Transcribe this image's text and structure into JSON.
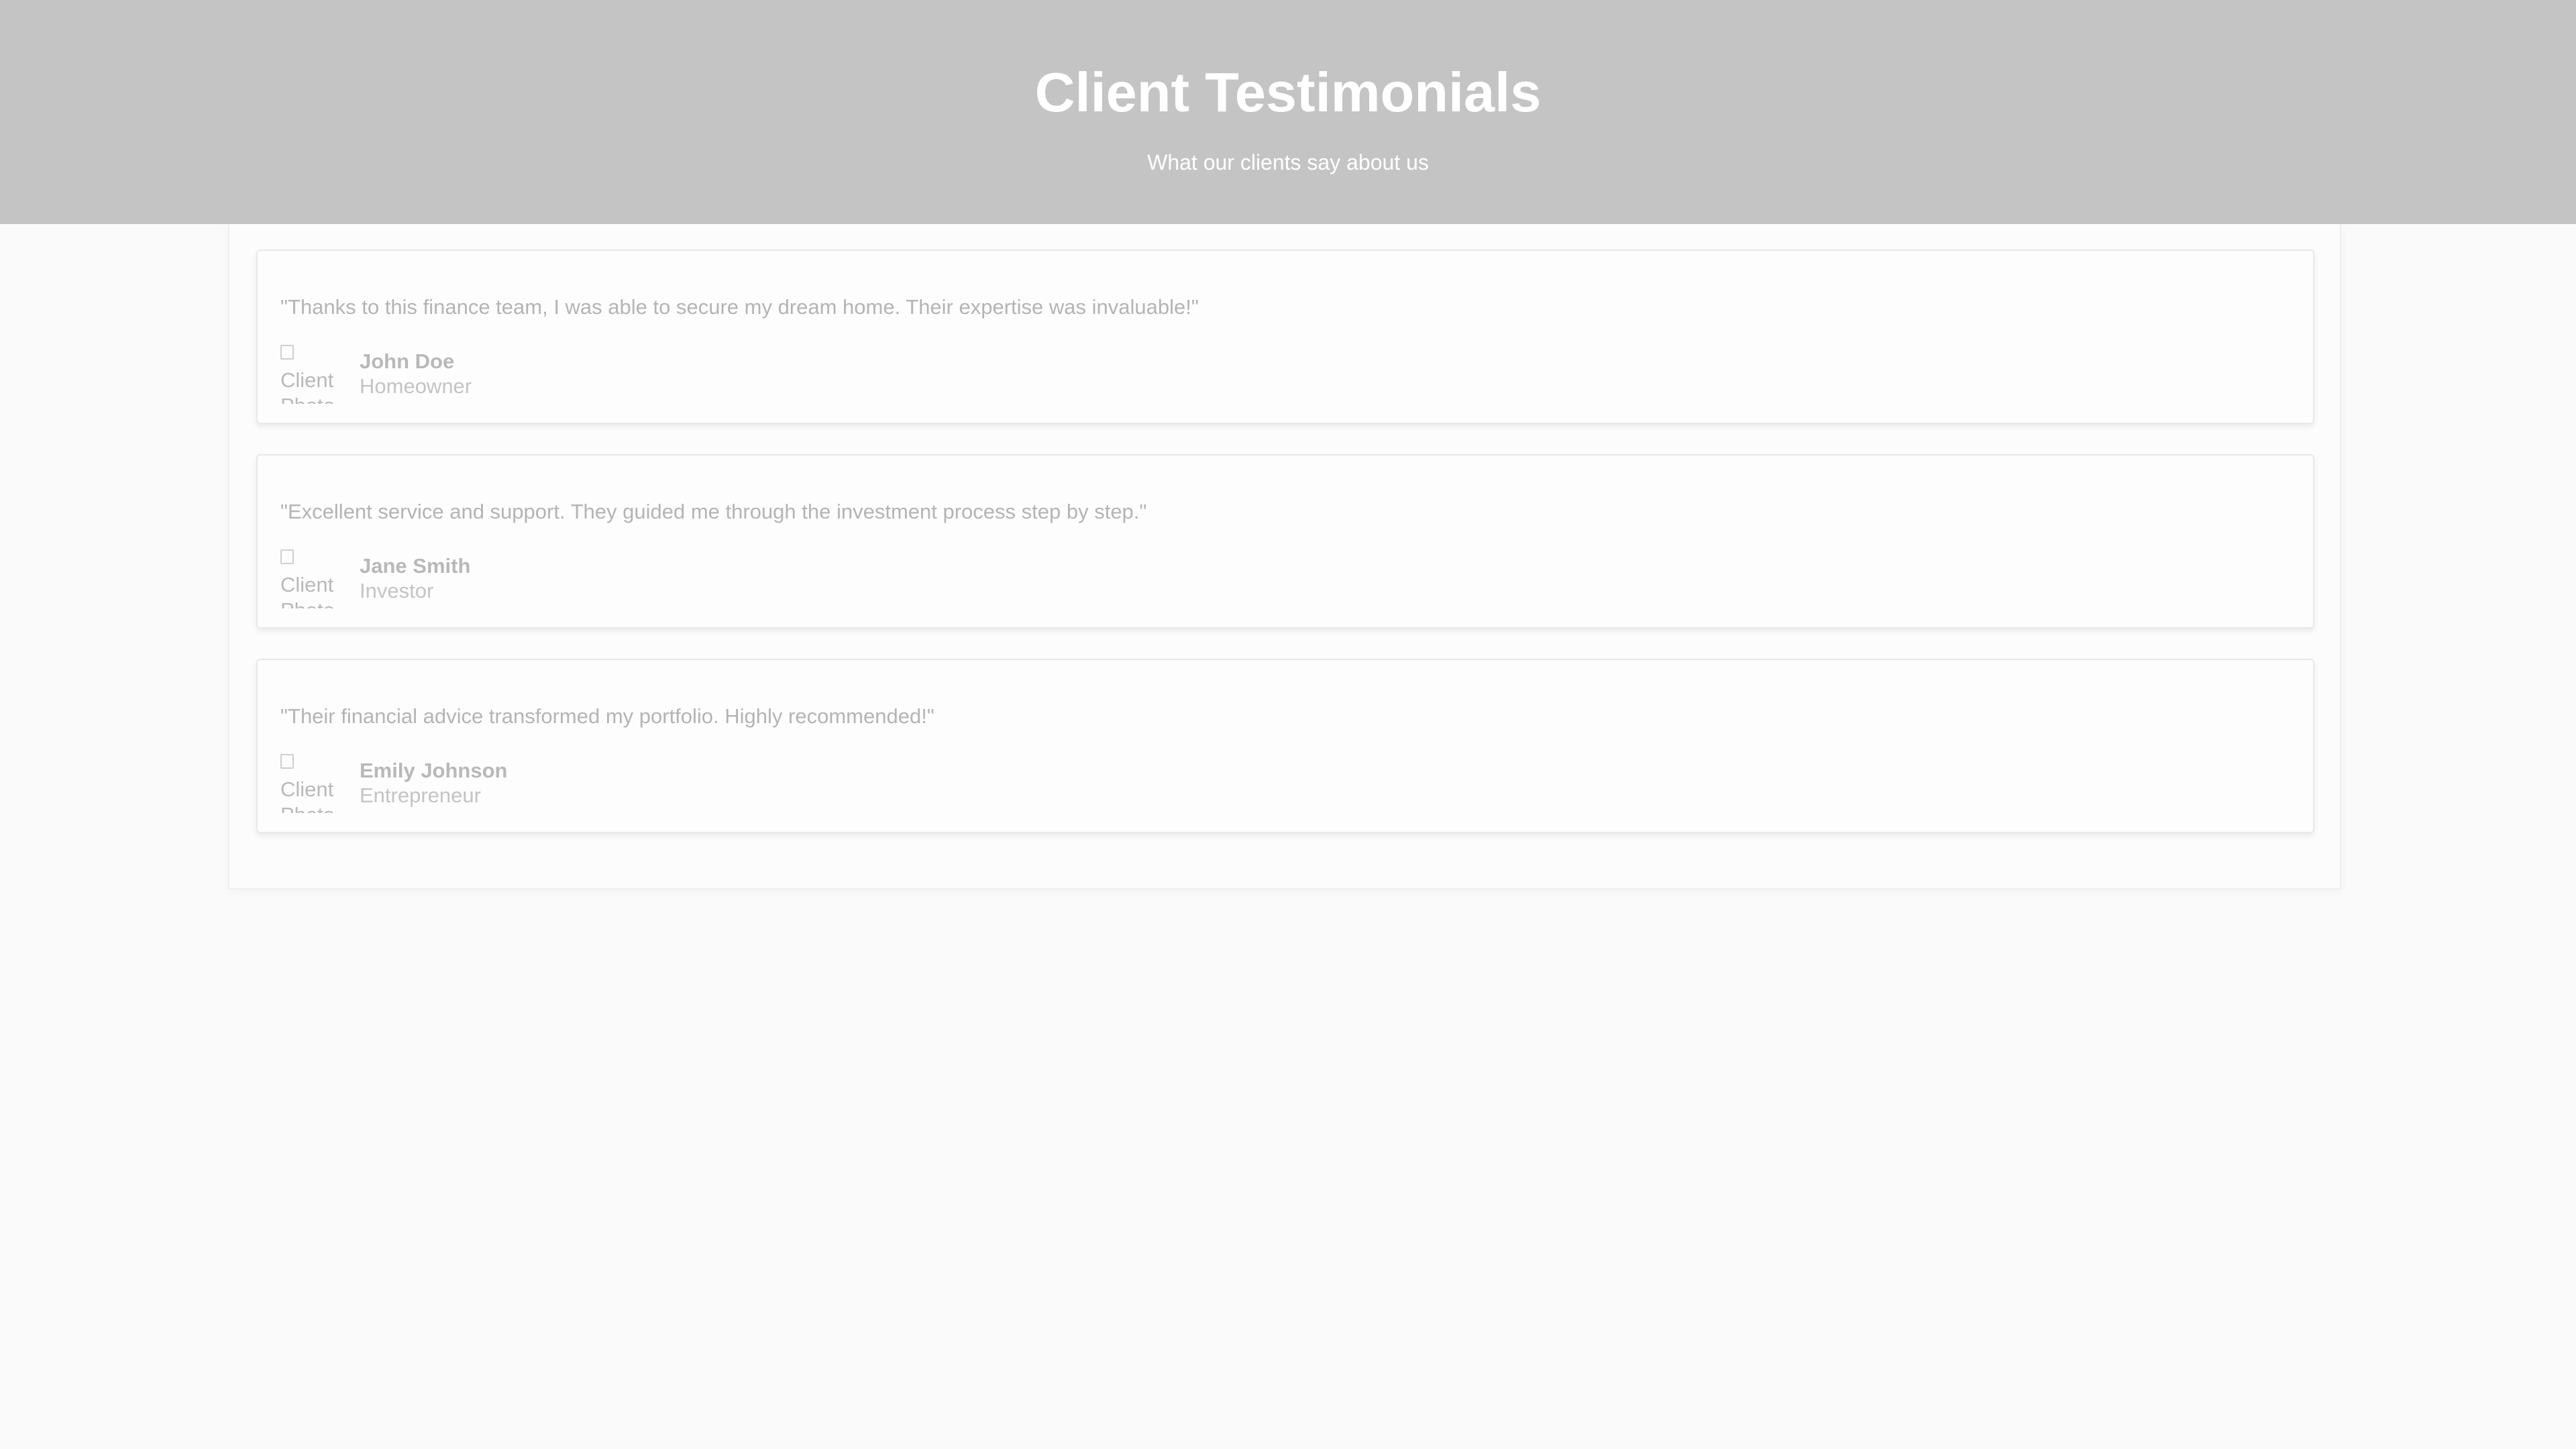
{
  "header": {
    "title": "Client Testimonials",
    "subtitle": "What our clients say about us"
  },
  "testimonials": [
    {
      "quote": "\"Thanks to this finance team, I was able to secure my dream home. Their expertise was invaluable!\"",
      "photo_alt": "Client Photo",
      "name": "John Doe",
      "role": "Homeowner"
    },
    {
      "quote": "\"Excellent service and support. They guided me through the investment process step by step.\"",
      "photo_alt": "Client Photo",
      "name": "Jane Smith",
      "role": "Investor"
    },
    {
      "quote": "\"Their financial advice transformed my portfolio. Highly recommended!\"",
      "photo_alt": "Client Photo",
      "name": "Emily Johnson",
      "role": "Entrepreneur"
    }
  ]
}
